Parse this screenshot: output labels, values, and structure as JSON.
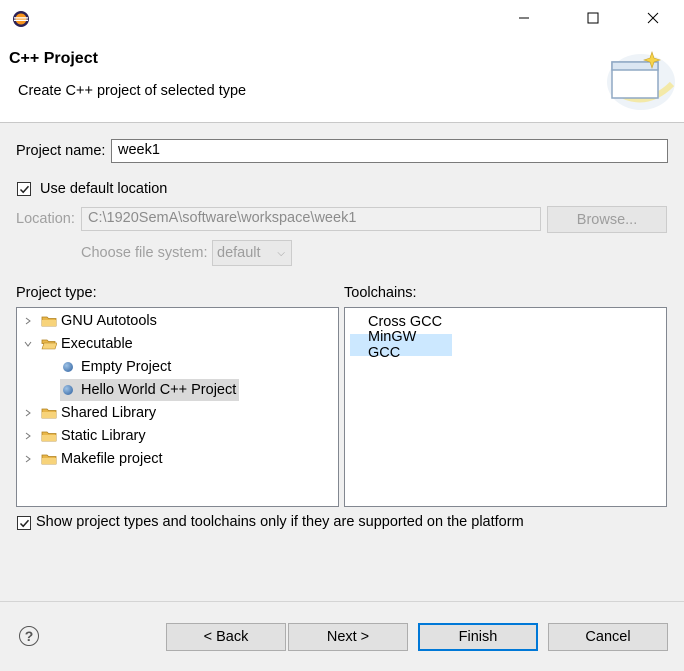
{
  "window": {
    "minimize": "—",
    "maximize": "☐",
    "close": "✕"
  },
  "header": {
    "title": "C++ Project",
    "subtitle": "Create C++ project of selected type"
  },
  "form": {
    "project_name_label": "Project name:",
    "project_name_value": "week1",
    "use_default_label": "Use default location",
    "use_default_checked": true,
    "location_label": "Location:",
    "location_value": "C:\\1920SemA\\software\\workspace\\week1",
    "browse_label": "Browse...",
    "filesystem_label": "Choose file system:",
    "filesystem_value": "default"
  },
  "project_type": {
    "label": "Project type:",
    "items": [
      {
        "label": "GNU Autotools",
        "kind": "folder",
        "expanded": false
      },
      {
        "label": "Executable",
        "kind": "folder",
        "expanded": true
      },
      {
        "label": "Empty Project",
        "kind": "leaf"
      },
      {
        "label": "Hello World C++ Project",
        "kind": "leaf",
        "selected": true
      },
      {
        "label": "Shared Library",
        "kind": "folder",
        "expanded": false
      },
      {
        "label": "Static Library",
        "kind": "folder",
        "expanded": false
      },
      {
        "label": "Makefile project",
        "kind": "folder",
        "expanded": false
      }
    ]
  },
  "toolchains": {
    "label": "Toolchains:",
    "items": [
      {
        "label": "Cross GCC"
      },
      {
        "label": "MinGW GCC",
        "selected": true
      }
    ]
  },
  "filter": {
    "label": "Show project types and toolchains only if they are supported on the platform",
    "checked": true
  },
  "footer": {
    "help": "?",
    "back": "< Back",
    "next": "Next >",
    "finish": "Finish",
    "cancel": "Cancel"
  },
  "colors": {
    "selection_toolchain": "#cce8ff",
    "selection_tree": "#d9d9d9",
    "default_button_border": "#0078d7"
  }
}
